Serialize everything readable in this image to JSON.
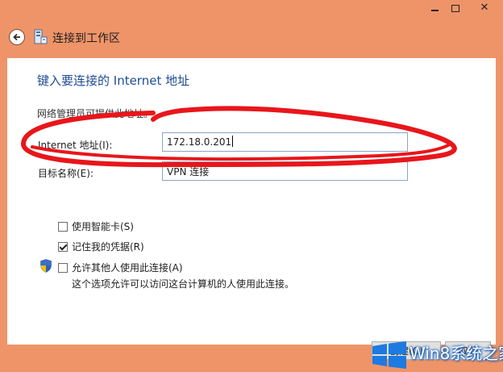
{
  "window": {
    "title": "连接到工作区",
    "caption_buttons": {
      "minimize_icon": "minimize-icon",
      "maximize_icon": "maximize-icon",
      "close_glyph": "✕"
    }
  },
  "page": {
    "heading": "键入要连接的 Internet 地址",
    "admin_note": "网络管理员可提供此地址。"
  },
  "form": {
    "internet_address": {
      "label": "Internet 地址(I):",
      "value": "172.18.0.201"
    },
    "destination_name": {
      "label": "目标名称(E):",
      "value": "VPN 连接"
    }
  },
  "options": [
    {
      "label": "使用智能卡(S)",
      "checked": false
    },
    {
      "label": "记住我的凭据(R)",
      "checked": true
    },
    {
      "label": "允许其他人使用此连接(A)",
      "checked": false
    }
  ],
  "allow_description": "这个选项允许可以访问这台计算机的人使用此连接。",
  "buttons": {
    "create": "创建(C)",
    "cancel": "取消"
  },
  "watermark": {
    "text": "Win8系统之家"
  },
  "colors": {
    "window_frame": "#ef9469",
    "heading": "#1f4d90",
    "annotation_stroke": "#e8161b"
  }
}
